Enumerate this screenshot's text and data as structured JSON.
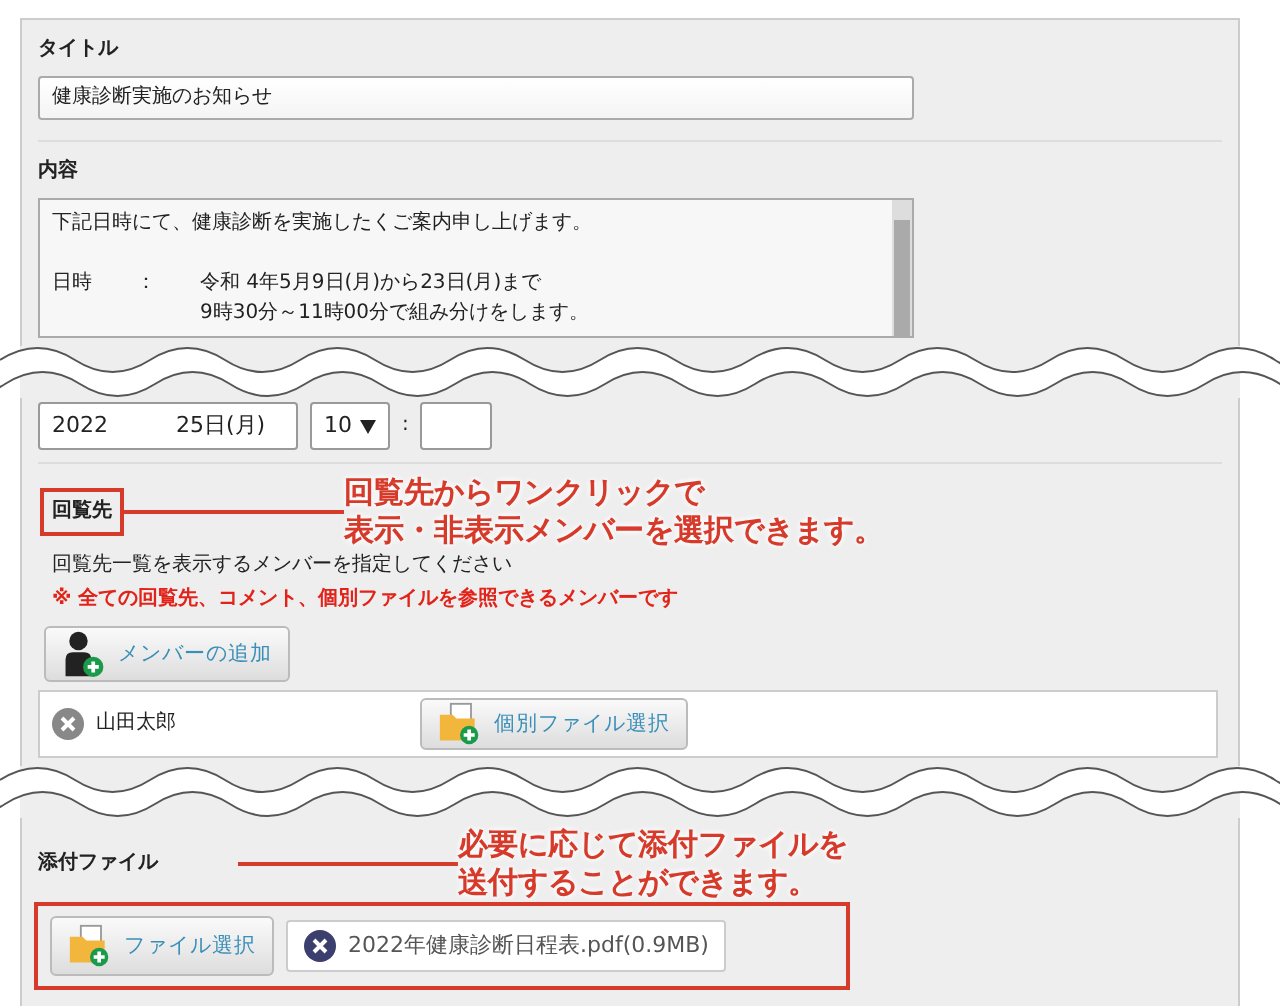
{
  "title_section": {
    "label": "タイトル",
    "value": "健康診断実施のお知らせ"
  },
  "content_section": {
    "label": "内容",
    "lines": [
      {
        "kind": "text",
        "text": "下記日時にて、健康診断を実施したくご案内申し上げます。"
      },
      {
        "kind": "blank"
      },
      {
        "kind": "row",
        "term": "日時",
        "sep": "：",
        "text": "令和 4年5月9日(月)から23日(月)まで"
      },
      {
        "kind": "cont",
        "text": "9時30分～11時00分で組み分けをします。"
      }
    ]
  },
  "schedule": {
    "date_start": "2022",
    "date_end": "25日(月)",
    "hour": "10",
    "separator": ":"
  },
  "circulation": {
    "label": "回覧先",
    "highlighted": true,
    "instruction": "回覧先一覧を表示するメンバーを指定してください",
    "note": "※ 全ての回覧先、コメント、個別ファイルを参照できるメンバーです",
    "add_button": "メンバーの追加",
    "members": [
      {
        "name": "山田太郎",
        "file_button": "個別ファイル選択"
      }
    ]
  },
  "attachments": {
    "label": "添付ファイル",
    "highlighted": true,
    "select_button": "ファイル選択",
    "files": [
      {
        "name": "2022年健康診断日程表.pdf(0.9MB)"
      }
    ]
  },
  "callouts": [
    {
      "lines": [
        "回覧先からワンクリックで",
        "表示・非表示メンバーを選択できます。"
      ]
    },
    {
      "lines": [
        "必要に応じて添付ファイルを",
        "送付することができます。"
      ]
    }
  ]
}
